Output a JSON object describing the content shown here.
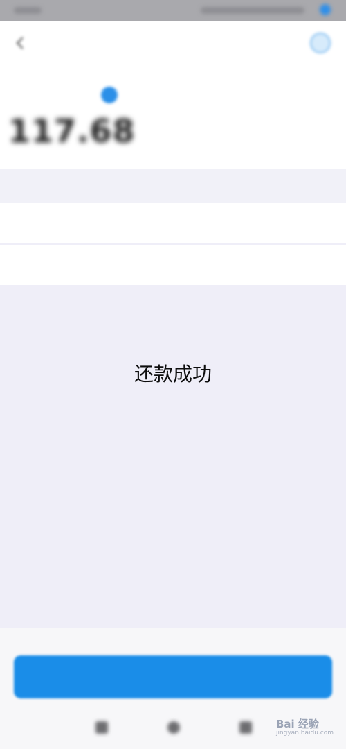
{
  "status_bar": {
    "time": "",
    "bluetooth_icon": "bluetooth-icon"
  },
  "nav": {
    "title": "",
    "back_icon": "chevron-left-icon",
    "help_icon": "help-circle-icon"
  },
  "amount_section": {
    "label": "",
    "value": "117.68",
    "check_icon": "check-circle-icon"
  },
  "details": {
    "header": "",
    "rows": [
      {
        "label": "",
        "value": ""
      },
      {
        "label": "",
        "value": ""
      }
    ]
  },
  "toast": {
    "message": "还款成功"
  },
  "footer": {
    "notice": "",
    "repay_button_label": ""
  },
  "watermark": {
    "text": "Bai 经验",
    "sub": "jingyan.baidu.com"
  },
  "colors": {
    "accent": "#1a8de8",
    "notice": "#e9573f",
    "background": "#efeef8"
  }
}
